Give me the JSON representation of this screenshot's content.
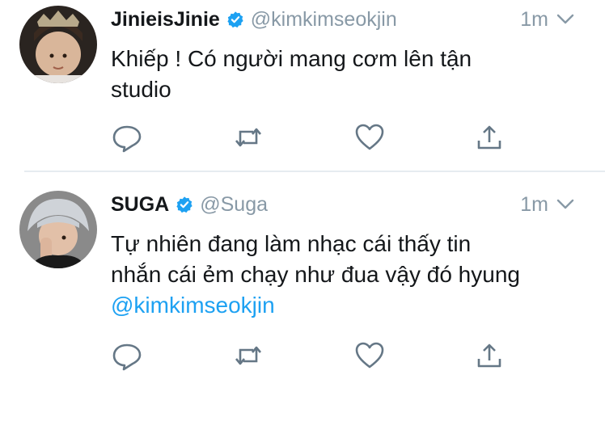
{
  "colors": {
    "text": "#14171a",
    "muted": "#8899a6",
    "link": "#1da1f2",
    "verified": "#1da1f2",
    "divider": "#e6ecf0"
  },
  "tweets": [
    {
      "display_name": "JinieisJinie",
      "handle": "@kimkimseokjin",
      "time": "1m",
      "verified": true,
      "text_lines": [
        "Khiếp ! Có người mang cơm lên tận",
        "studio"
      ],
      "mention": ""
    },
    {
      "display_name": "SUGA",
      "handle": "@Suga",
      "time": "1m",
      "verified": true,
      "text_lines": [
        "Tự nhiên đang làm nhạc cái thấy tin",
        "nhắn cái ẻm chạy như đua vậy đó hyung"
      ],
      "mention": "@kimkimseokjin"
    }
  ],
  "icons": [
    "reply-icon",
    "retweet-icon",
    "like-icon",
    "share-icon",
    "verified-badge-icon",
    "chevron-down-icon"
  ]
}
